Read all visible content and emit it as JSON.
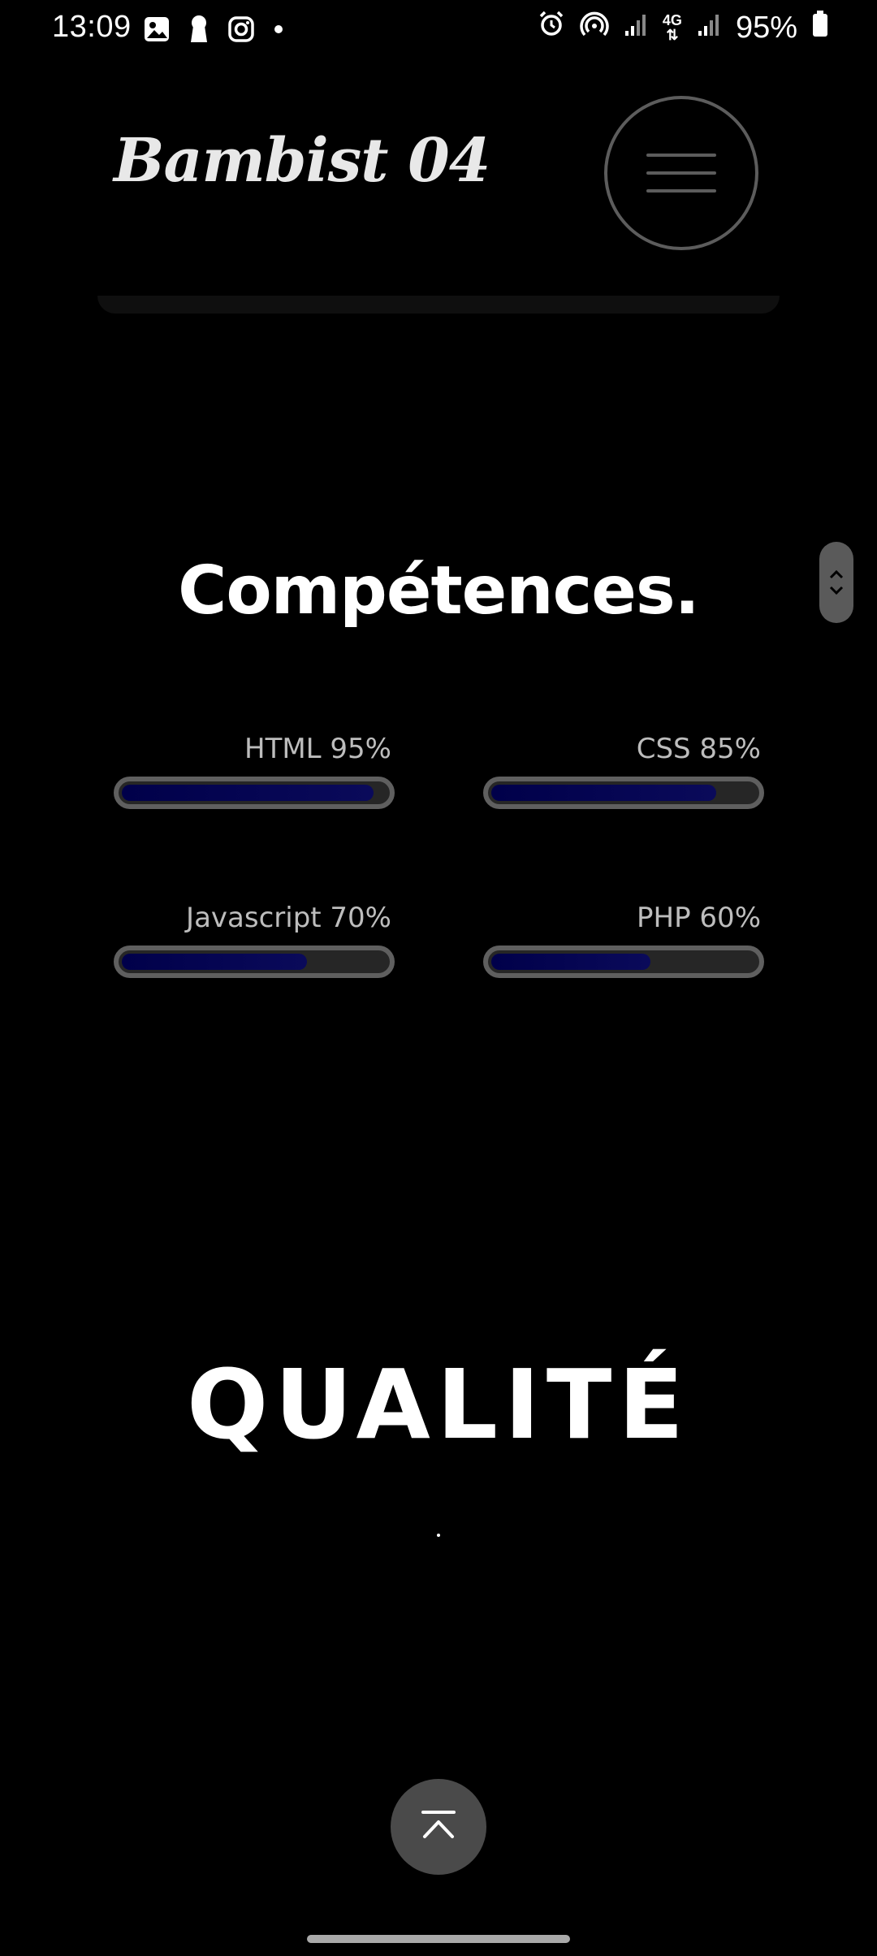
{
  "status_bar": {
    "time": "13:09",
    "battery": "95%",
    "left_icons": [
      "gallery-icon",
      "keyhole-icon",
      "instagram-icon",
      "dot-icon"
    ],
    "right_icons": [
      "alarm-icon",
      "hotspot-icon",
      "signal-icon",
      "4g-icon",
      "signal-icon",
      "battery-icon"
    ],
    "network": "4G"
  },
  "header": {
    "logo": "Bambist 04",
    "menu_icon": "hamburger-icon"
  },
  "skills_section": {
    "title": "Compétences.",
    "skills": [
      {
        "label": "HTML 95%",
        "percent": 95
      },
      {
        "label": "CSS 85%",
        "percent": 85
      },
      {
        "label": "Javascript 70%",
        "percent": 70
      },
      {
        "label": "PHP 60%",
        "percent": 60
      }
    ]
  },
  "quality_section": {
    "title": "QUALITÉ"
  },
  "back_to_top": {
    "icon": "arrow-up-to-top-icon"
  },
  "colors": {
    "background": "#000000",
    "bar_fill": "#00004a",
    "bar_border": "#5f5f5f"
  }
}
